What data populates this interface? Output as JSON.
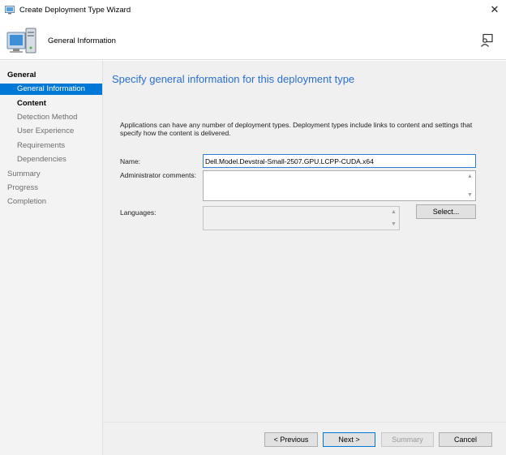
{
  "window": {
    "title": "Create Deployment Type Wizard",
    "close_glyph": "✕"
  },
  "header": {
    "title": "General Information",
    "icon": "computer-monitor-icon",
    "help_icon": "help-person-icon"
  },
  "sidebar": {
    "items": [
      {
        "label": "General",
        "level": 0,
        "state": "bold"
      },
      {
        "label": "General Information",
        "level": 1,
        "state": "selected"
      },
      {
        "label": "Content",
        "level": 1,
        "state": "bold"
      },
      {
        "label": "Detection Method",
        "level": 1,
        "state": "normal"
      },
      {
        "label": "User Experience",
        "level": 1,
        "state": "normal"
      },
      {
        "label": "Requirements",
        "level": 1,
        "state": "normal"
      },
      {
        "label": "Dependencies",
        "level": 1,
        "state": "normal"
      },
      {
        "label": "Summary",
        "level": 0,
        "state": "normal"
      },
      {
        "label": "Progress",
        "level": 0,
        "state": "normal"
      },
      {
        "label": "Completion",
        "level": 0,
        "state": "normal"
      }
    ]
  },
  "main": {
    "heading": "Specify general information for this deployment type",
    "description": "Applications can have any number of deployment types. Deployment types include links to content and settings that specify how the content is delivered.",
    "name_label": "Name:",
    "name_value": "Dell.Model.Devstral-Small-2507.GPU.LCPP-CUDA.x64",
    "comments_label": "Administrator comments:",
    "comments_value": "",
    "languages_label": "Languages:",
    "select_button": "Select..."
  },
  "footer": {
    "previous": "< Previous",
    "next": "Next >",
    "summary": "Summary",
    "cancel": "Cancel"
  },
  "colors": {
    "accent": "#0078d7",
    "heading": "#2a6ed3"
  }
}
